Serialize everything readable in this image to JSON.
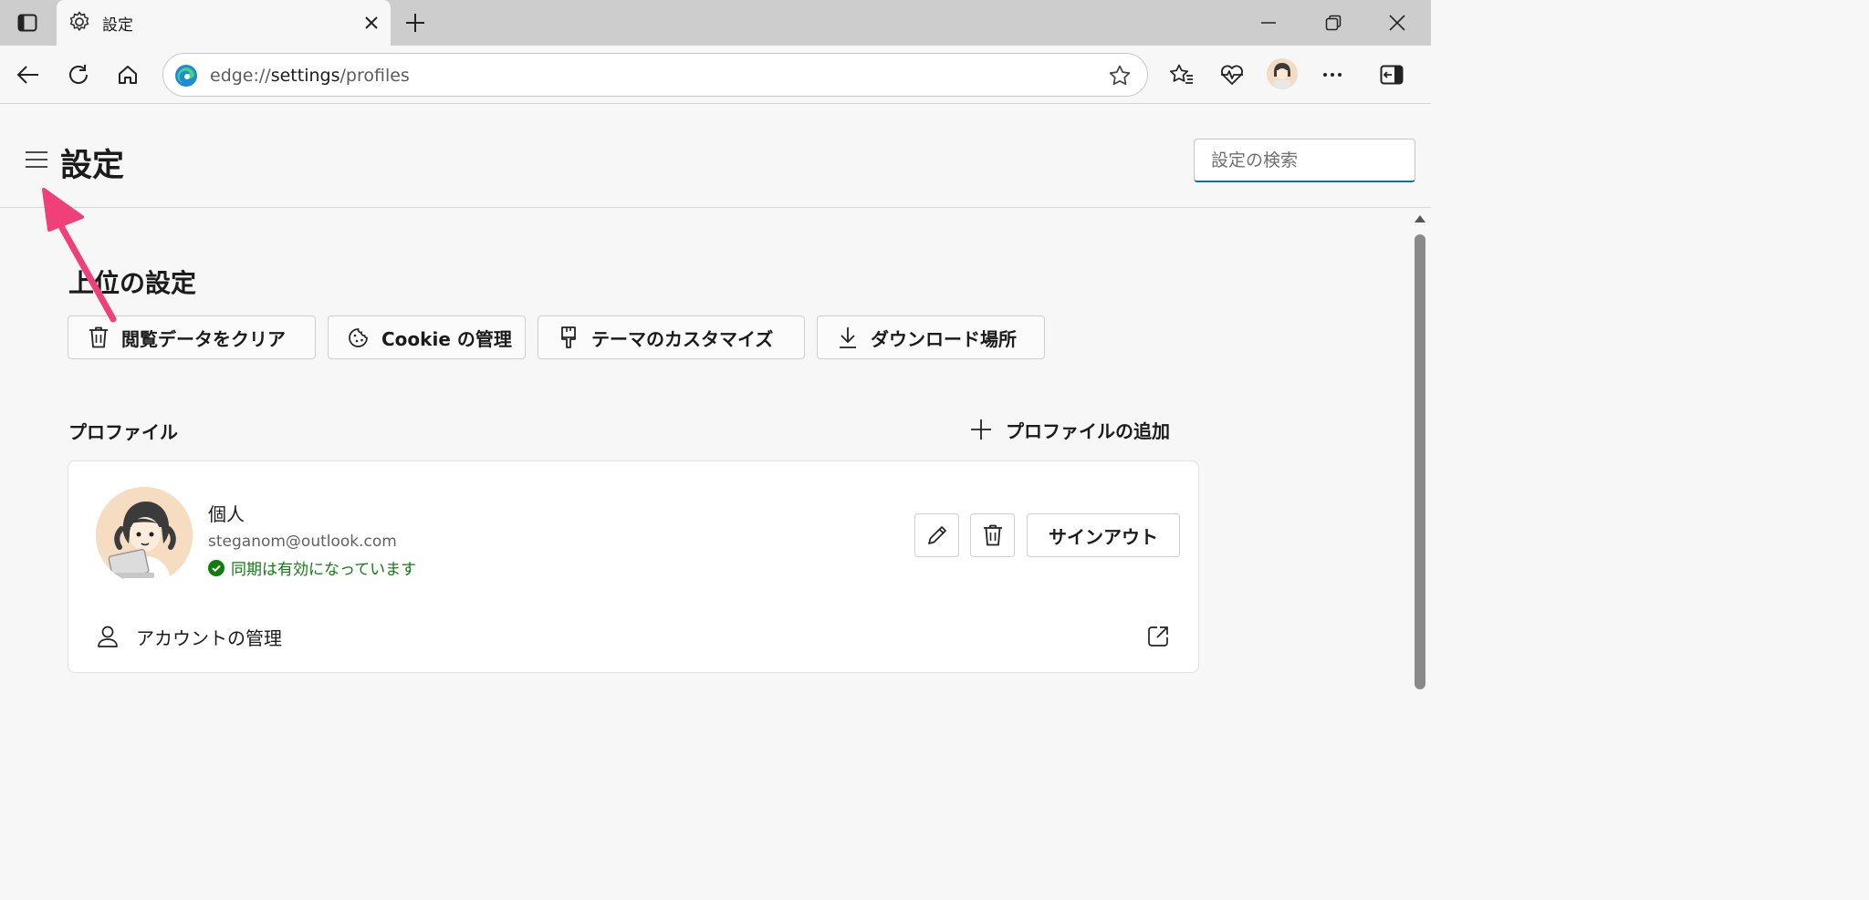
{
  "browser": {
    "tab": {
      "title": "設定",
      "favicon": "gear-icon"
    },
    "address_bar": {
      "scheme": "edge://",
      "host": "settings",
      "path": "/profiles"
    },
    "window_controls": [
      "minimize-icon",
      "restore-icon",
      "close-icon"
    ],
    "toolbar_icons": [
      "back-icon",
      "refresh-icon",
      "home-icon",
      "favorites-icon",
      "performance-icon",
      "profile-avatar",
      "more-icon",
      "sidebar-icon"
    ]
  },
  "settings": {
    "title": "設定",
    "search_placeholder": "設定の検索"
  },
  "top_settings": {
    "heading": "上位の設定",
    "chips": [
      {
        "label": "閲覧データをクリア",
        "icon": "trash-icon"
      },
      {
        "label": "Cookie の管理",
        "icon": "cookie-icon"
      },
      {
        "label": "テーマのカスタマイズ",
        "icon": "paintbrush-icon"
      },
      {
        "label": "ダウンロード場所",
        "icon": "download-icon"
      }
    ]
  },
  "profiles": {
    "label": "プロファイル",
    "add_label": "プロファイルの追加",
    "card": {
      "name": "個人",
      "email": "steganom@outlook.com",
      "sync_status": "同期は有効になっています",
      "sync_color": "#107c10",
      "signout_label": "サインアウト",
      "manage_account_label": "アカウントの管理"
    }
  },
  "colors": {
    "accent": "#0f6cbd",
    "annotation_arrow": "#f0407a"
  }
}
